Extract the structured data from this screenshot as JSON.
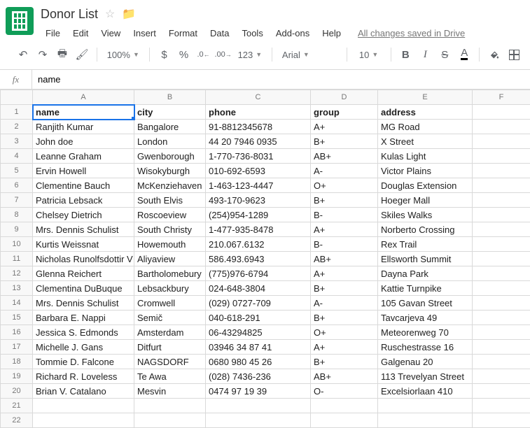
{
  "doc": {
    "title": "Donor List"
  },
  "menu": {
    "file": "File",
    "edit": "Edit",
    "view": "View",
    "insert": "Insert",
    "format": "Format",
    "data": "Data",
    "tools": "Tools",
    "addons": "Add-ons",
    "help": "Help",
    "save_status": "All changes saved in Drive"
  },
  "toolbar": {
    "zoom": "100%",
    "currency": "$",
    "percent": "%",
    "dec_dec": ".0",
    "inc_dec": ".00",
    "more_formats": "123",
    "font": "Arial",
    "font_size": "10",
    "bold": "B",
    "italic": "I",
    "strike": "S",
    "text_color": "A"
  },
  "formula_bar": {
    "fx": "fx",
    "value": "name"
  },
  "columns": [
    "A",
    "B",
    "C",
    "D",
    "E",
    "F"
  ],
  "headers": {
    "name": "name",
    "city": "city",
    "phone": "phone",
    "group": "group",
    "address": "address"
  },
  "chart_data": {
    "type": "table",
    "columns": [
      "name",
      "city",
      "phone",
      "group",
      "address"
    ],
    "rows": [
      {
        "name": "Ranjith Kumar",
        "city": "Bangalore",
        "phone": "91-8812345678",
        "group": "A+",
        "address": "MG Road"
      },
      {
        "name": "John doe",
        "city": "London",
        "phone": "44 20 7946 0935",
        "group": "B+",
        "address": "X Street"
      },
      {
        "name": "Leanne Graham",
        "city": "Gwenborough",
        "phone": "1-770-736-8031",
        "group": "AB+",
        "address": "Kulas Light"
      },
      {
        "name": "Ervin Howell",
        "city": "Wisokyburgh",
        "phone": "010-692-6593",
        "group": "A-",
        "address": "Victor Plains"
      },
      {
        "name": "Clementine Bauch",
        "city": "McKenziehaven",
        "phone": "1-463-123-4447",
        "group": "O+",
        "address": "Douglas Extension"
      },
      {
        "name": "Patricia Lebsack",
        "city": "South Elvis",
        "phone": "493-170-9623",
        "group": "B+",
        "address": "Hoeger Mall"
      },
      {
        "name": "Chelsey Dietrich",
        "city": "Roscoeview",
        "phone": "(254)954-1289",
        "group": "B-",
        "address": "Skiles Walks"
      },
      {
        "name": "Mrs. Dennis Schulist",
        "city": "South Christy",
        "phone": "1-477-935-8478",
        "group": "A+",
        "address": "Norberto Crossing"
      },
      {
        "name": "Kurtis Weissnat",
        "city": "Howemouth",
        "phone": "210.067.6132",
        "group": "B-",
        "address": "Rex Trail"
      },
      {
        "name": "Nicholas Runolfsdottir V",
        "city": "Aliyaview",
        "phone": "586.493.6943",
        "group": "AB+",
        "address": "Ellsworth Summit"
      },
      {
        "name": "Glenna Reichert",
        "city": "Bartholomebury",
        "phone": "(775)976-6794",
        "group": "A+",
        "address": "Dayna Park"
      },
      {
        "name": "Clementina DuBuque",
        "city": "Lebsackbury",
        "phone": "024-648-3804",
        "group": "B+",
        "address": "Kattie Turnpike"
      },
      {
        "name": "Mrs. Dennis Schulist",
        "city": "Cromwell",
        "phone": "(029) 0727-709",
        "group": "A-",
        "address": "105 Gavan Street"
      },
      {
        "name": "Barbara E. Nappi",
        "city": "Semič",
        "phone": "040-618-291",
        "group": "B+",
        "address": "Tavcarjeva 49"
      },
      {
        "name": "Jessica S. Edmonds",
        "city": "Amsterdam",
        "phone": "06-43294825",
        "group": "O+",
        "address": "Meteorenweg 70"
      },
      {
        "name": "Michelle J. Gans",
        "city": "Ditfurt",
        "phone": "03946 34 87 41",
        "group": "A+",
        "address": "Ruschestrasse 16"
      },
      {
        "name": "Tommie D. Falcone",
        "city": "NAGSDORF",
        "phone": "0680 980 45 26",
        "group": "B+",
        "address": "Galgenau 20"
      },
      {
        "name": "Richard R. Loveless",
        "city": "Te Awa",
        "phone": "(028) 7436-236",
        "group": "AB+",
        "address": "113 Trevelyan Street"
      },
      {
        "name": "Brian V. Catalano",
        "city": "Mesvin",
        "phone": "0474 97 19 39",
        "group": "O-",
        "address": "Excelsiorlaan 410"
      }
    ]
  },
  "row_numbers": [
    "1",
    "2",
    "3",
    "4",
    "5",
    "6",
    "7",
    "8",
    "9",
    "10",
    "11",
    "12",
    "13",
    "14",
    "15",
    "16",
    "17",
    "18",
    "19",
    "20",
    "21",
    "22"
  ]
}
